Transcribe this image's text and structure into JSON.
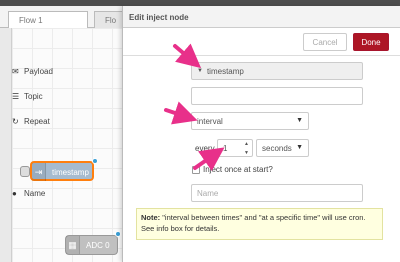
{
  "tabs": [
    {
      "label": "Flow 1"
    },
    {
      "label": "Flo"
    }
  ],
  "nodes": {
    "inject_label": "timestamp",
    "adc_label": "ADC 0"
  },
  "panel": {
    "title": "Edit inject node",
    "cancel_label": "Cancel",
    "done_label": "Done"
  },
  "form": {
    "payload_label": "Payload",
    "payload_value": "timestamp",
    "topic_label": "Topic",
    "topic_value": "",
    "repeat_label": "Repeat",
    "repeat_value": "interval",
    "every_label": "every",
    "every_value": "1",
    "unit_value": "seconds",
    "inject_once_label": "Inject once at start?",
    "name_label": "Name",
    "name_placeholder": "Name"
  },
  "note": {
    "bold": "Note:",
    "text": " \"interval between times\" and \"at a specific time\" will use cron. See info box for details."
  },
  "colors": {
    "done_button": "#ad1625",
    "annotation_arrow": "#e8308a",
    "selected_node_border": "#ff7f0e",
    "port_dot": "#3a9fd6"
  },
  "icons": {
    "payload": "envelope-icon",
    "topic": "tasks-icon",
    "repeat": "repeat-icon",
    "name": "tag-icon"
  }
}
